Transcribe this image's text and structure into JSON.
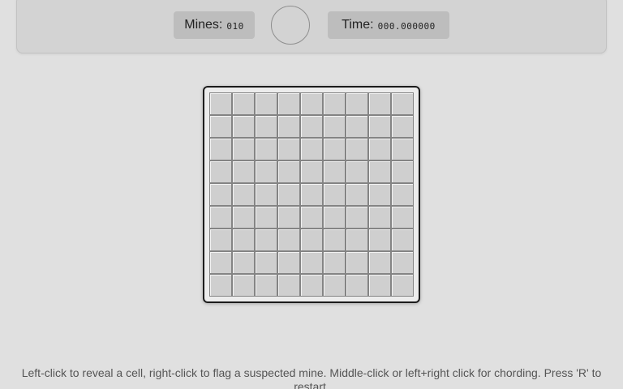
{
  "header": {
    "mines_label": "Mines:",
    "mines_value": "010",
    "face_glyph": "",
    "face_icon": "smiley-face-icon",
    "time_label": "Time:",
    "time_value": "000.000000"
  },
  "board": {
    "rows": 9,
    "cols": 9,
    "state": "all-covered"
  },
  "instructions": "Left-click to reveal a cell, right-click to flag a suspected mine. Middle-click or left+right click for chording. Press 'R' to restart.",
  "colors": {
    "background": "#e0e0e0",
    "header_bg": "#d3d3d3",
    "counter_bg": "#bdbdbd",
    "cell_bg": "#cfcfcf",
    "board_border": "#1c1c1c"
  }
}
